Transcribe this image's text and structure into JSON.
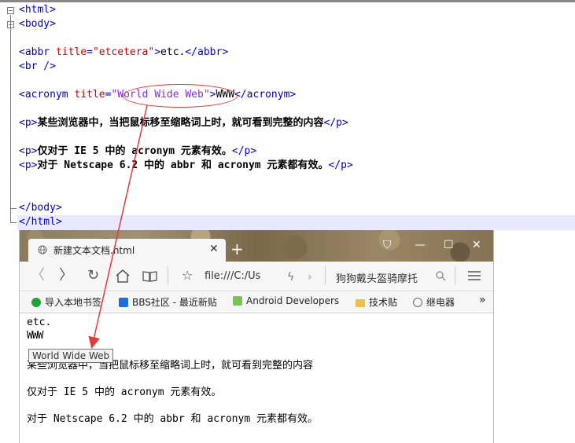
{
  "editor": {
    "lines": [
      {
        "tag_open": "<html>"
      },
      {
        "tag_open": "<body>"
      },
      {
        "abbr_open": "<abbr",
        "abbr_attr": "title",
        "abbr_eq": "=",
        "abbr_val": "\"etcetera\"",
        "abbr_close": ">",
        "abbr_text": "etc.",
        "abbr_end": "</abbr>"
      },
      {
        "br": "<br />"
      },
      {
        "ac_open": "<acronym",
        "ac_attr": "title",
        "ac_eq": "=",
        "ac_val": "\"World Wide Web\"",
        "ac_close": ">",
        "ac_text": "WWW",
        "ac_end": "</acronym>"
      },
      {
        "p_open": "<p>",
        "p_text": "某些浏览器中，当把鼠标移至缩略词上时，就可看到完整的内容",
        "p_close": "</p>"
      },
      {
        "p_open": "<p>",
        "p_text": "仅对于 IE 5 中的 acronym 元素有效。",
        "p_close": "</p>"
      },
      {
        "p_open": "<p>",
        "p_text": "对于 Netscape 6.2 中的 abbr 和 acronym 元素都有效。",
        "p_close": "</p>"
      },
      {
        "tag_close": "</body>"
      },
      {
        "tag_close": "</html>"
      }
    ]
  },
  "browser": {
    "tab_title": "新建文本文档.html",
    "tab_close": "✕",
    "new_tab": "+",
    "url": "file:///C:/Us",
    "search": "狗狗戴头盔骑摩托",
    "bookmarks": [
      {
        "label": "导入本地书签",
        "color": "#21a23b"
      },
      {
        "label": "BBS社区 - 最近新贴",
        "color": "#1e6fd6"
      },
      {
        "label": "Android Developers",
        "color": "#78c257"
      },
      {
        "label": "技术贴",
        "color": "#e8c04a"
      },
      {
        "label": "继电器",
        "color": "#666666"
      }
    ],
    "more": "»",
    "page": {
      "line1": "etc.",
      "line2": "WWW",
      "tooltip": "World Wide Web",
      "p1": "某些浏览器中，当把鼠标移至缩略词上时，就可看到完整的内容",
      "p2": "仅对于 IE 5 中的 acronym 元素有效。",
      "p3": "对于 Netscape 6.2 中的 abbr 和 acronym 元素都有效。"
    }
  },
  "colors": {
    "annotation": "#e23b3b",
    "tag": "#0000cc",
    "attr": "#cc0000",
    "value": "#8a2be2"
  }
}
